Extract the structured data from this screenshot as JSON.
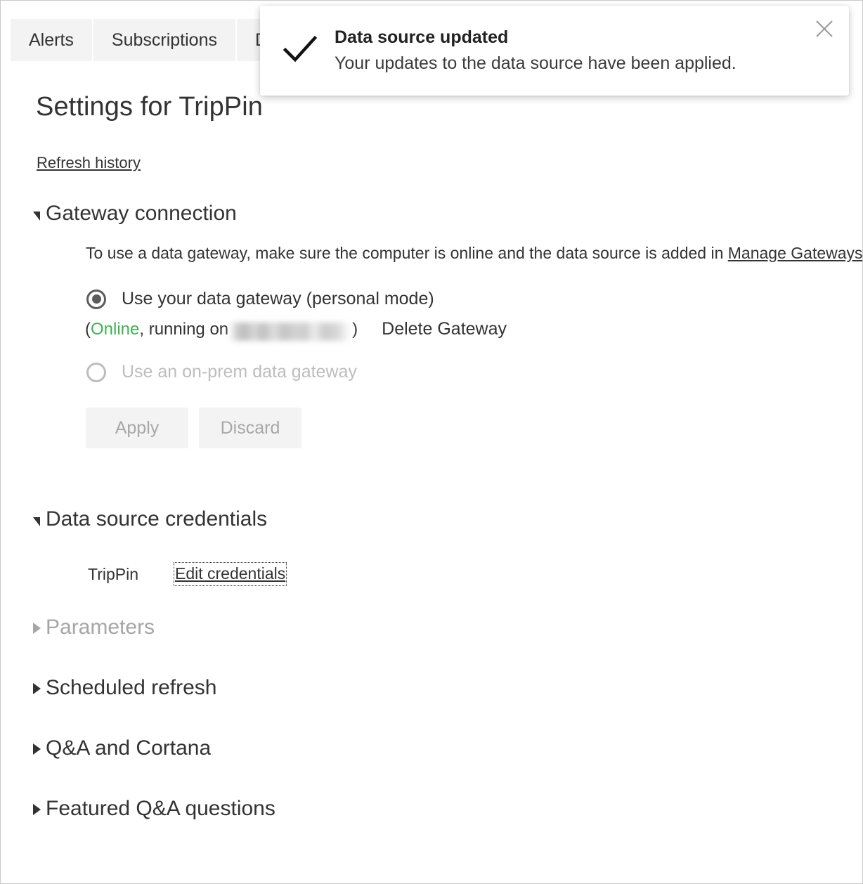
{
  "tabs": [
    {
      "label": "Alerts"
    },
    {
      "label": "Subscriptions"
    },
    {
      "label": "D"
    }
  ],
  "page": {
    "title": "Settings for TripPin",
    "refresh_history_label": "Refresh history"
  },
  "toast": {
    "icon": "checkmark-icon",
    "title": "Data source updated",
    "message": "Your updates to the data source have been applied.",
    "close_icon": "close-icon"
  },
  "gateway_section": {
    "title": "Gateway connection",
    "expanded": true,
    "description_prefix": "To use a data gateway, make sure the computer is online and the data source is added in ",
    "description_link": "Manage Gateways",
    "description_suffix": ".",
    "options": [
      {
        "label": "Use your data gateway (personal mode)",
        "selected": true,
        "disabled": false
      },
      {
        "label": "Use an on-prem data gateway",
        "selected": false,
        "disabled": true
      }
    ],
    "status_open_paren": "(",
    "status_state": "Online",
    "status_state_color": "#3eb34f",
    "status_running_on": ", running on ",
    "status_machine_name": "",
    "status_close_paren": ")",
    "delete_gateway_label": "Delete Gateway",
    "apply_label": "Apply",
    "discard_label": "Discard"
  },
  "credentials_section": {
    "title": "Data source credentials",
    "expanded": true,
    "rows": [
      {
        "name": "TripPin",
        "action_label": "Edit credentials"
      }
    ]
  },
  "collapsed_sections": [
    {
      "title": "Parameters",
      "disabled": true
    },
    {
      "title": "Scheduled refresh",
      "disabled": false
    },
    {
      "title": "Q&A and Cortana",
      "disabled": false
    },
    {
      "title": "Featured Q&A questions",
      "disabled": false
    }
  ]
}
